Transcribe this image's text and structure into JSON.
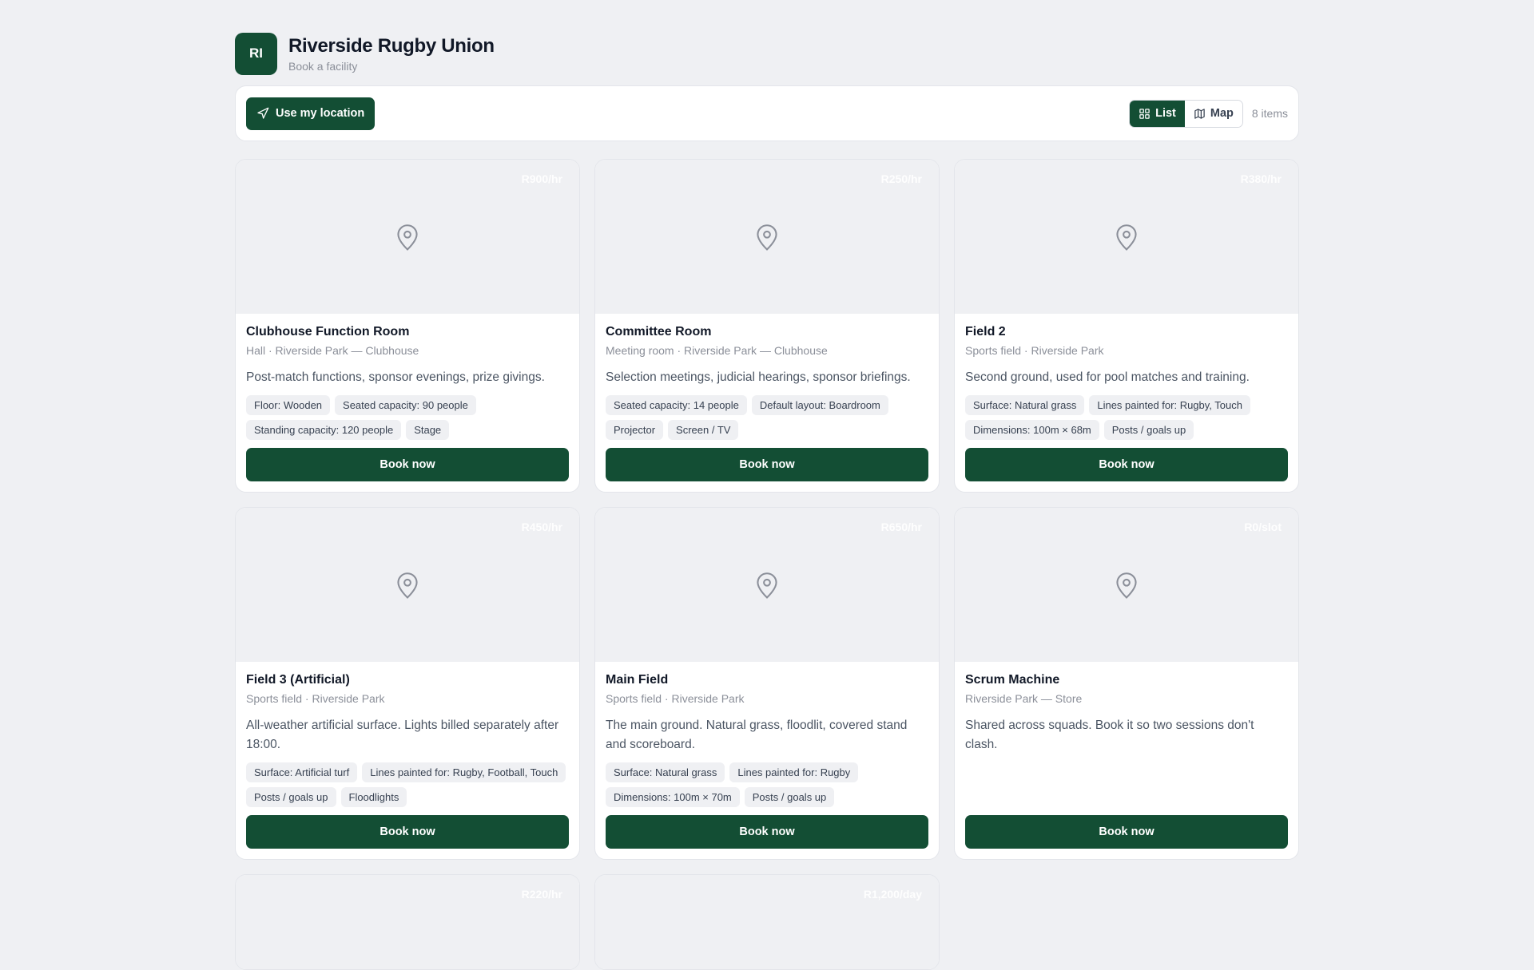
{
  "header": {
    "logo_text": "RI",
    "title": "Riverside Rugby Union",
    "subtitle": "Book a facility"
  },
  "toolbar": {
    "location_label": "Use my location",
    "view_list": "List",
    "view_map": "Map",
    "count": "8 items",
    "active_view": "List"
  },
  "colors": {
    "brand": "#134e34",
    "background": "#eff0f3"
  },
  "cards": [
    {
      "price": "R900/hr",
      "title": "Clubhouse Function Room",
      "subtitle": "Hall · Riverside Park — Clubhouse",
      "description": "Post-match functions, sponsor evenings, prize givings.",
      "tags": [
        "Floor: Wooden",
        "Seated capacity: 90 people",
        "Standing capacity: 120 people",
        "Stage"
      ],
      "button": "Book now"
    },
    {
      "price": "R250/hr",
      "title": "Committee Room",
      "subtitle": "Meeting room · Riverside Park — Clubhouse",
      "description": "Selection meetings, judicial hearings, sponsor briefings.",
      "tags": [
        "Seated capacity: 14 people",
        "Default layout: Boardroom",
        "Projector",
        "Screen / TV"
      ],
      "button": "Book now"
    },
    {
      "price": "R380/hr",
      "title": "Field 2",
      "subtitle": "Sports field · Riverside Park",
      "description": "Second ground, used for pool matches and training.",
      "tags": [
        "Surface: Natural grass",
        "Lines painted for: Rugby, Touch",
        "Dimensions: 100m × 68m",
        "Posts / goals up"
      ],
      "button": "Book now"
    },
    {
      "price": "R450/hr",
      "title": "Field 3 (Artificial)",
      "subtitle": "Sports field · Riverside Park",
      "description": "All-weather artificial surface. Lights billed separately after 18:00.",
      "tags": [
        "Surface: Artificial turf",
        "Lines painted for: Rugby, Football, Touch",
        "Posts / goals up",
        "Floodlights"
      ],
      "button": "Book now"
    },
    {
      "price": "R650/hr",
      "title": "Main Field",
      "subtitle": "Sports field · Riverside Park",
      "description": "The main ground. Natural grass, floodlit, covered stand and scoreboard.",
      "tags": [
        "Surface: Natural grass",
        "Lines painted for: Rugby",
        "Dimensions: 100m × 70m",
        "Posts / goals up"
      ],
      "button": "Book now"
    },
    {
      "price": "R0/slot",
      "title": "Scrum Machine",
      "subtitle": "Riverside Park — Store",
      "description": "Shared across squads. Book it so two sessions don't clash.",
      "tags": [],
      "button": "Book now"
    }
  ],
  "partial_cards": [
    {
      "price": "R220/hr"
    },
    {
      "price": "R1,200/day"
    }
  ]
}
